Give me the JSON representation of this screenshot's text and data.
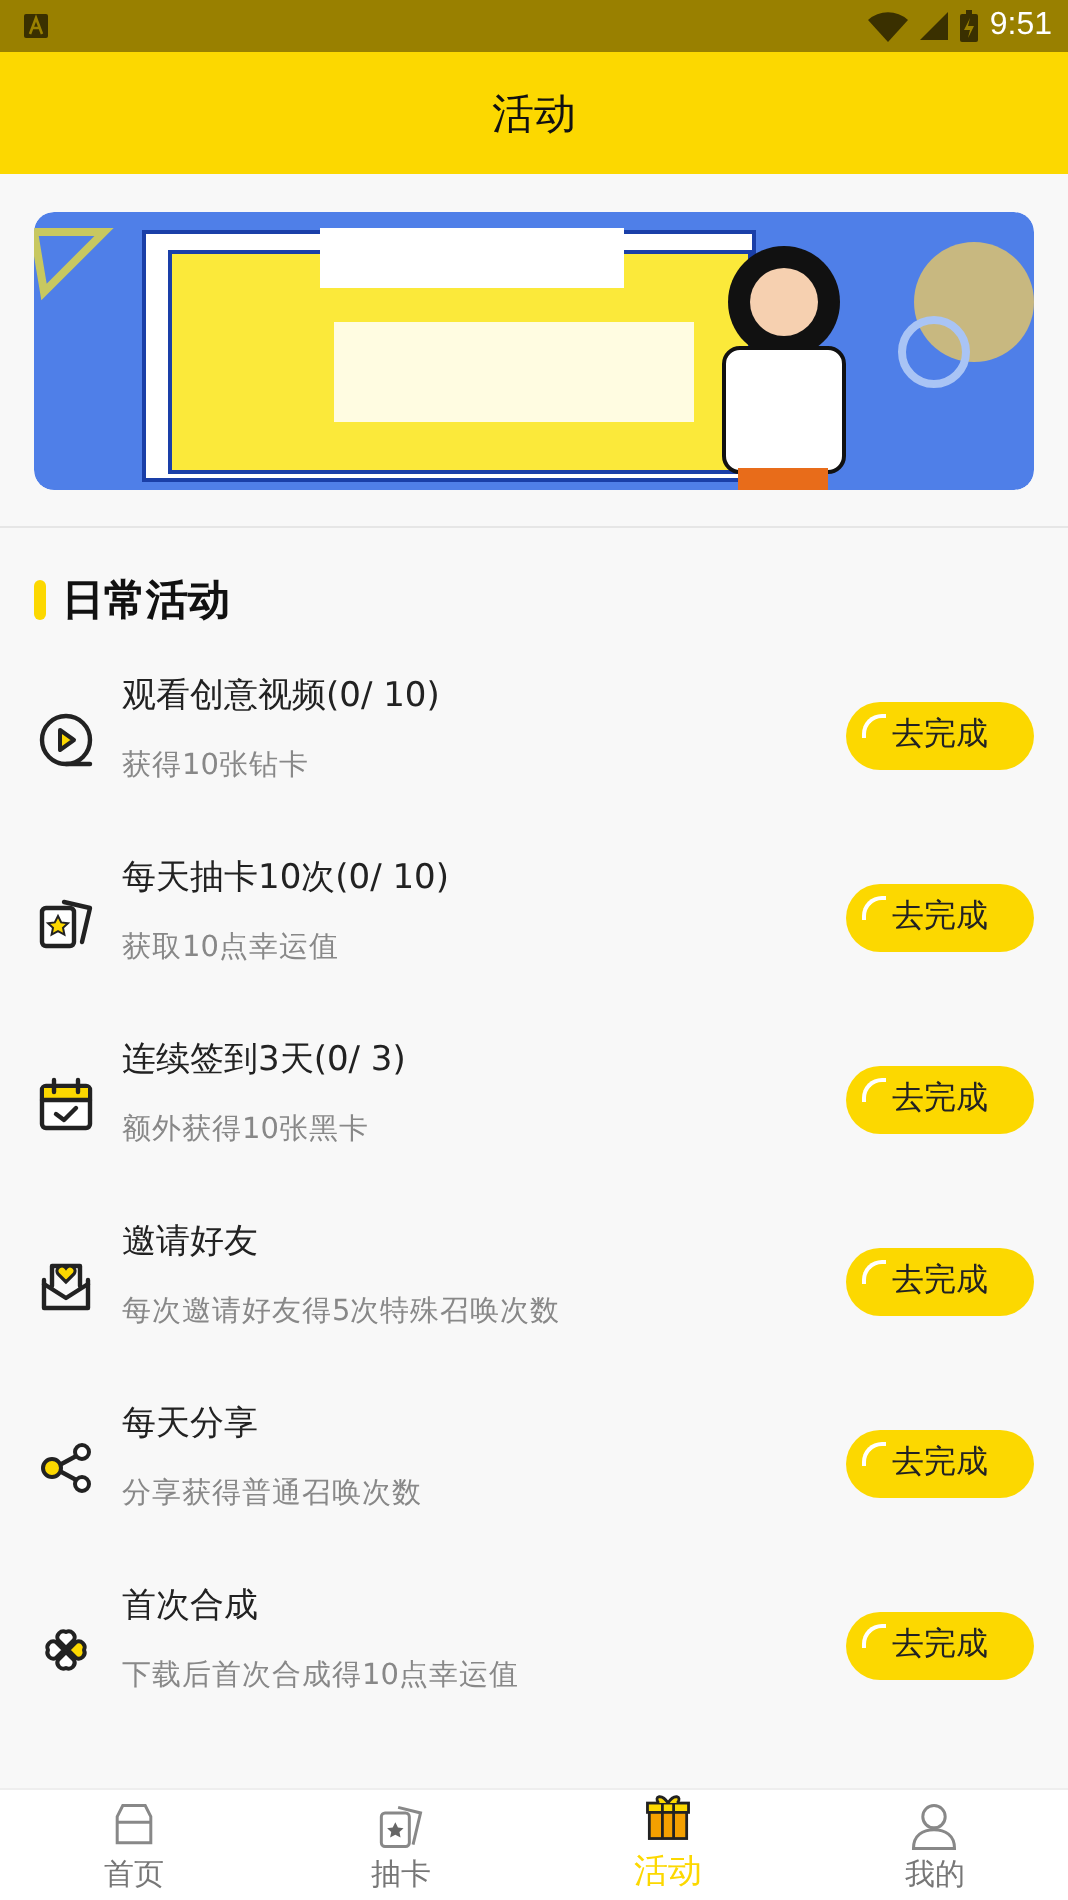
{
  "status_bar": {
    "time": "9:51"
  },
  "header": {
    "title": "活动"
  },
  "section": {
    "title": "日常活动"
  },
  "tasks": [
    {
      "kind": "video",
      "title": "观看创意视频(0/ 10)",
      "subtitle": "获得10张钻卡",
      "button": "去完成"
    },
    {
      "kind": "cards",
      "title": "每天抽卡10次(0/ 10)",
      "subtitle": "获取10点幸运值",
      "button": "去完成"
    },
    {
      "kind": "calendar",
      "title": "连续签到3天(0/ 3)",
      "subtitle": "额外获得10张黑卡",
      "button": "去完成"
    },
    {
      "kind": "envelope",
      "title": "邀请好友",
      "subtitle": "每次邀请好友得5次特殊召唤次数",
      "button": "去完成"
    },
    {
      "kind": "share",
      "title": "每天分享",
      "subtitle": "分享获得普通召唤次数",
      "button": "去完成"
    },
    {
      "kind": "clover",
      "title": "首次合成",
      "subtitle": "下载后首次合成得10点幸运值",
      "button": "去完成"
    }
  ],
  "tab_bar": [
    {
      "kind": "home",
      "label": "首页",
      "selected": false
    },
    {
      "kind": "cards",
      "label": "抽卡",
      "selected": false
    },
    {
      "kind": "gift",
      "label": "活动",
      "selected": true
    },
    {
      "kind": "person",
      "label": "我的",
      "selected": false
    }
  ]
}
